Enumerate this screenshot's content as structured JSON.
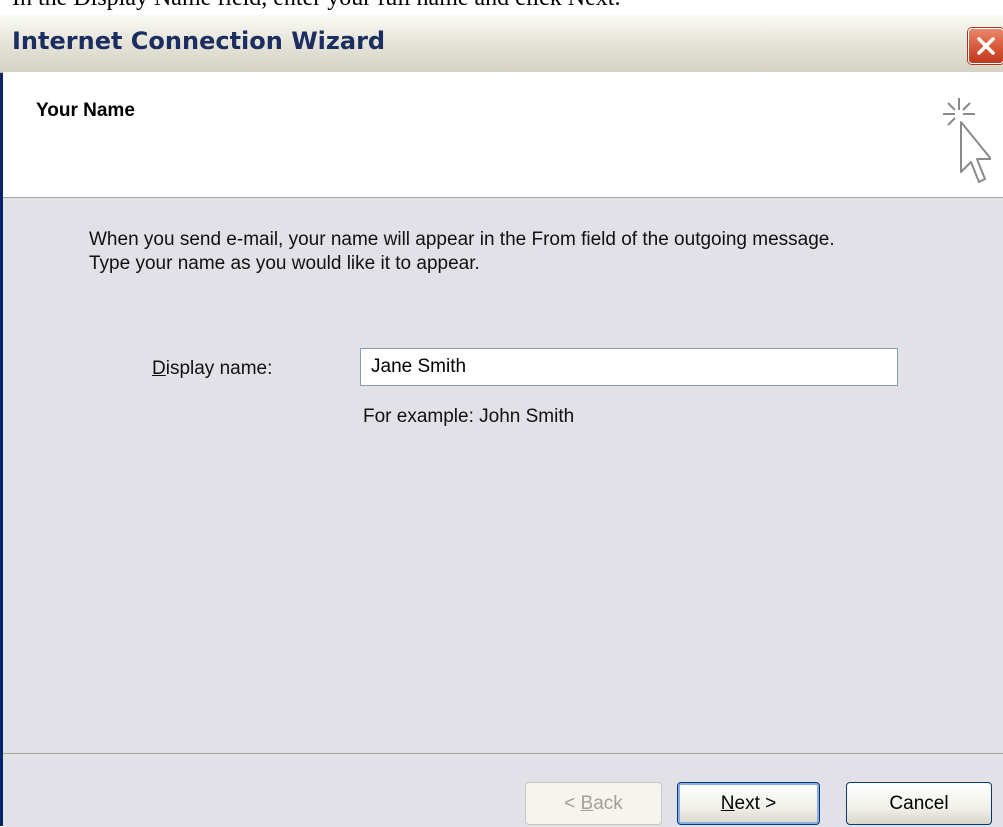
{
  "document": {
    "instruction": "In the Display Name field, enter your full name and click Next."
  },
  "window": {
    "title": "Internet Connection Wizard"
  },
  "header": {
    "title": "Your Name"
  },
  "body": {
    "intro_line1": "When you send e-mail, your name will appear in the From field of the outgoing message.",
    "intro_line2": "Type your name as you would like it to appear.",
    "display_name_label_accel": "D",
    "display_name_label_rest": "isplay name:",
    "display_name_value": "Jane Smith",
    "example_text": "For example: John Smith"
  },
  "buttons": {
    "back_prefix": "< ",
    "back_accel": "B",
    "back_rest": "ack",
    "next_accel": "N",
    "next_rest": "ext >",
    "cancel": "Cancel"
  },
  "icons": {
    "close": "close-icon",
    "wizard": "cursor-sparkle-icon"
  },
  "colors": {
    "title_text": "#1b2e62",
    "close_button": "#d7573a",
    "panel_bg": "#e2e1e8"
  }
}
